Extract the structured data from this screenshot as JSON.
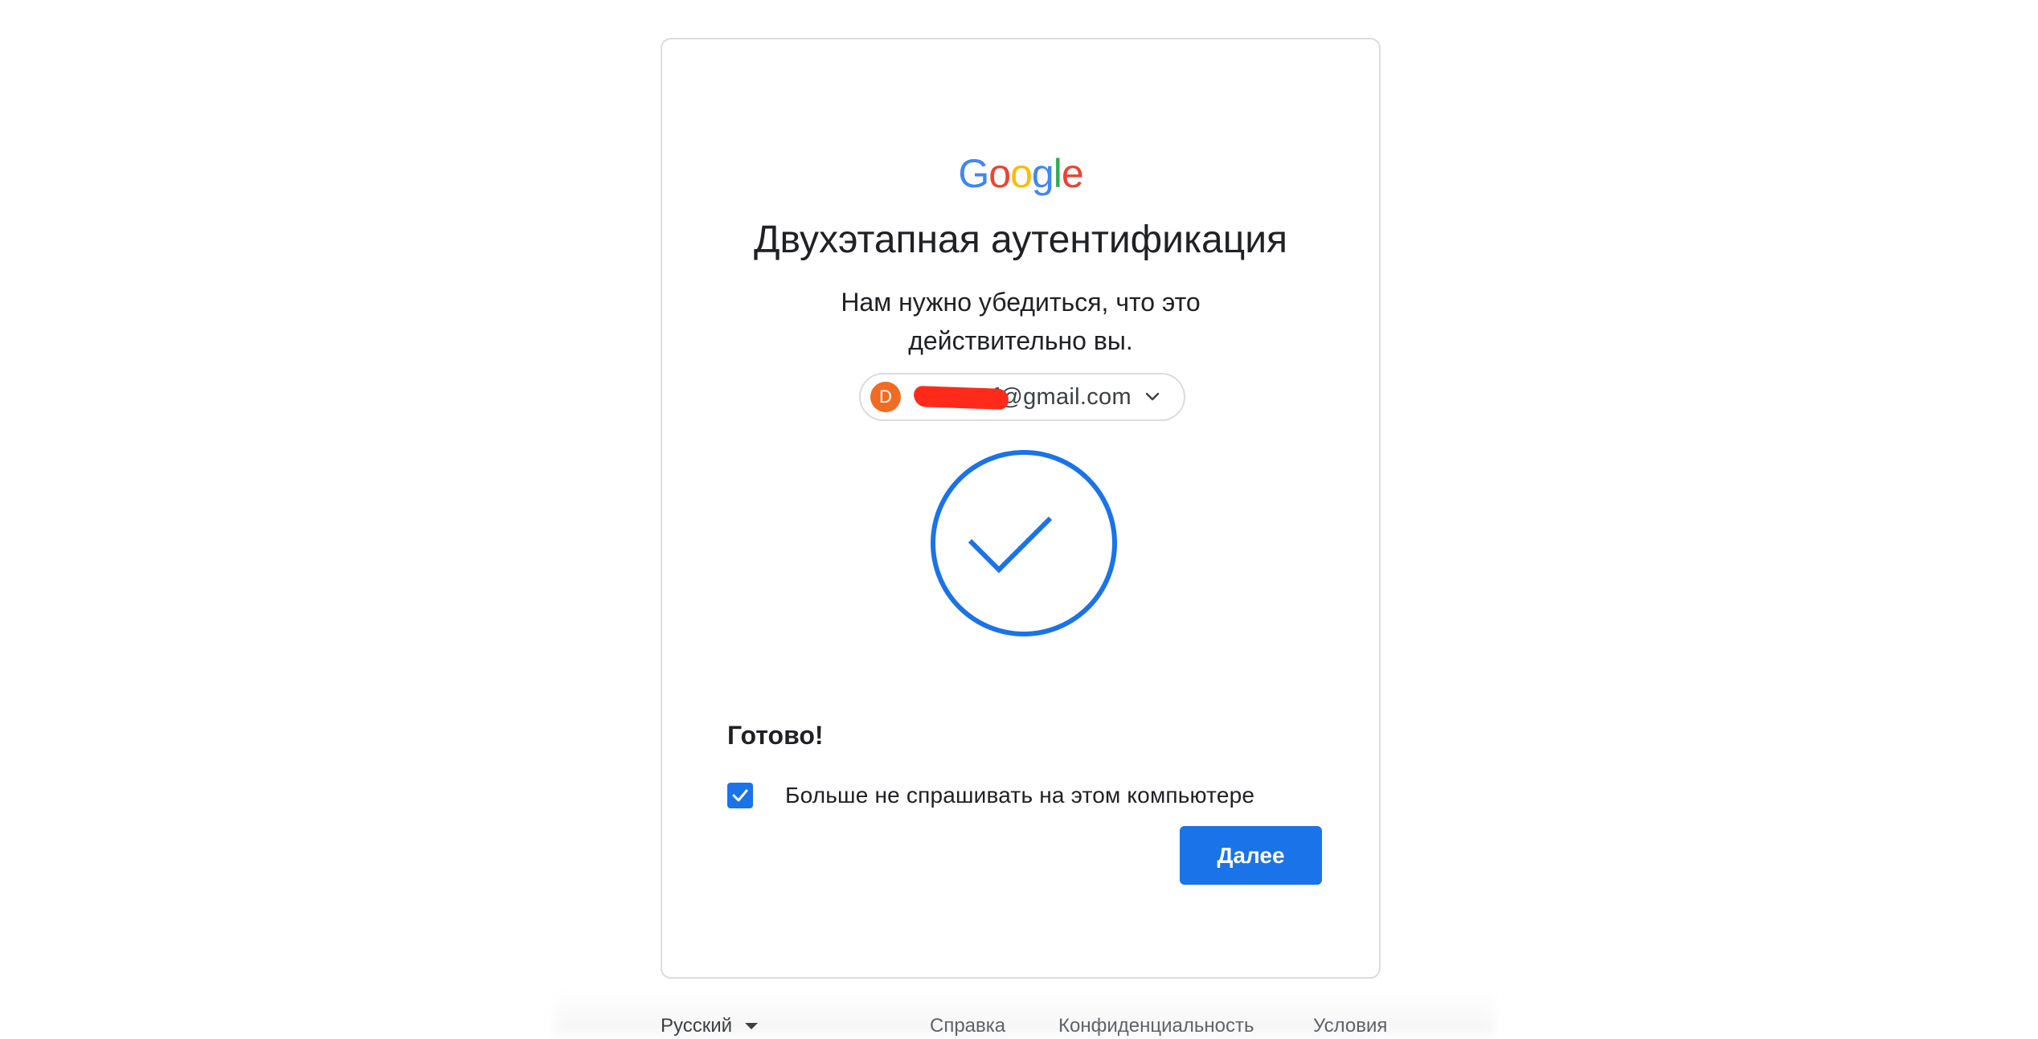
{
  "logo": {
    "letters": [
      "G",
      "o",
      "o",
      "g",
      "l",
      "e"
    ],
    "colors": [
      "#4285F4",
      "#EA4335",
      "#FBBC05",
      "#4285F4",
      "#34A853",
      "#EA4335"
    ]
  },
  "title": "Двухэтапная аутентификация",
  "subtitle": "Нам нужно убедиться, что это действительно вы.",
  "account": {
    "avatar_letter": "D",
    "email_visible": "f@gmail.com",
    "icon": "chevron-down-icon"
  },
  "status_icon": "check-circle-icon",
  "done_label": "Готово!",
  "remember_checkbox": {
    "checked": true,
    "label": "Больше не спрашивать на этом компьютере"
  },
  "next_button": "Далее",
  "footer": {
    "language": "Русский",
    "links": [
      "Справка",
      "Конфиденциальность",
      "Условия"
    ]
  },
  "colors": {
    "accent": "#1a73e8",
    "avatar": "#ef6c22",
    "redaction": "#ff2a1a"
  }
}
